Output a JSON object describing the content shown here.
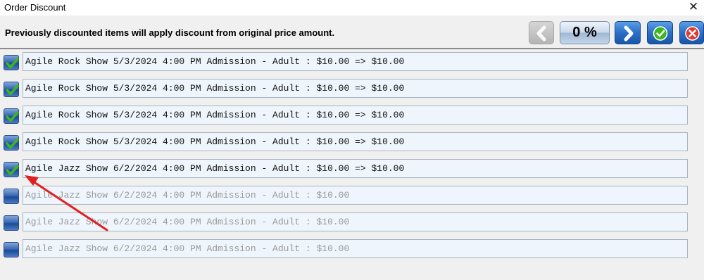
{
  "window": {
    "title": "Order Discount",
    "close_glyph": "✕"
  },
  "header": {
    "notice": "Previously discounted items will apply discount from original price amount.",
    "percent": "0 %",
    "buttons": {
      "prev_icon": "chevron-left-icon",
      "next_icon": "chevron-right-icon",
      "ok_icon": "checkmark-circle-icon",
      "cancel_icon": "x-circle-icon"
    }
  },
  "items": [
    {
      "text": "Agile Rock Show 5/3/2024 4:00 PM Admission - Adult : $10.00 => $10.00",
      "checked": true
    },
    {
      "text": "Agile Rock Show 5/3/2024 4:00 PM Admission - Adult : $10.00 => $10.00",
      "checked": true
    },
    {
      "text": "Agile Rock Show 5/3/2024 4:00 PM Admission - Adult : $10.00 => $10.00",
      "checked": true
    },
    {
      "text": "Agile Rock Show 5/3/2024 4:00 PM Admission - Adult : $10.00 => $10.00",
      "checked": true
    },
    {
      "text": "Agile Jazz Show 6/2/2024 4:00 PM Admission - Adult : $10.00 => $10.00",
      "checked": true
    },
    {
      "text": "Agile Jazz Show 6/2/2024 4:00 PM Admission - Adult : $10.00",
      "checked": false
    },
    {
      "text": "Agile Jazz Show 6/2/2024 4:00 PM Admission - Adult : $10.00",
      "checked": false
    },
    {
      "text": "Agile Jazz Show 6/2/2024 4:00 PM Admission - Adult : $10.00",
      "checked": false
    }
  ],
  "colors": {
    "accent_blue": "#2c6fc6",
    "check_green": "#3cb81e",
    "annotation_red": "#e02020",
    "field_bg": "#eef5fc"
  }
}
